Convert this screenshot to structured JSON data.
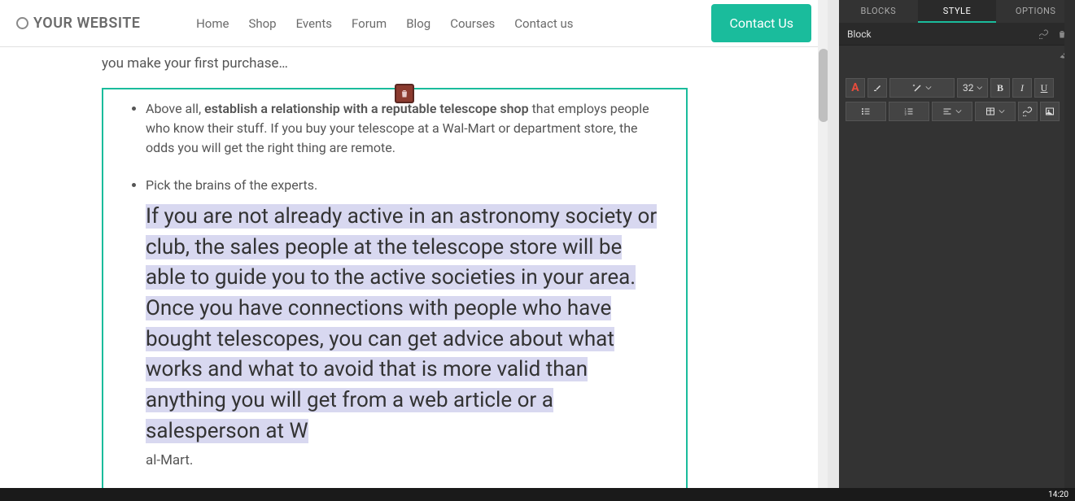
{
  "header": {
    "logo_text": "YOUR WEBSITE",
    "nav": [
      "Home",
      "Shop",
      "Events",
      "Forum",
      "Blog",
      "Courses",
      "Contact us"
    ],
    "contact_btn": "Contact Us"
  },
  "content": {
    "intro": "you make your first purchase…",
    "bullets": [
      {
        "before": "Above all, ",
        "strong": "establish a relationship with a reputable telescope shop",
        "after": " that employs people who know their stuff. If you buy your telescope at a Wal-Mart or department store, the odds you will get the right thing are remote."
      },
      {
        "lead": "Pick the brains of the experts.",
        "big_selected": "If you are not already active in an astronomy society or club, the sales people at the telescope store will be able to guide you to the active societies in your area. Once you have connections with people who have bought telescopes, you can get advice about what works and what to avoid that is more valid than anything you will get from a web article or a salesperson at W",
        "after": "al-Mart."
      }
    ]
  },
  "sidebar": {
    "tabs": {
      "blocks": "BLOCKS",
      "style": "STYLE",
      "options": "OPTIONS"
    },
    "block_label": "Block",
    "font_size": "32"
  },
  "taskbar": {
    "time": "14:20"
  }
}
